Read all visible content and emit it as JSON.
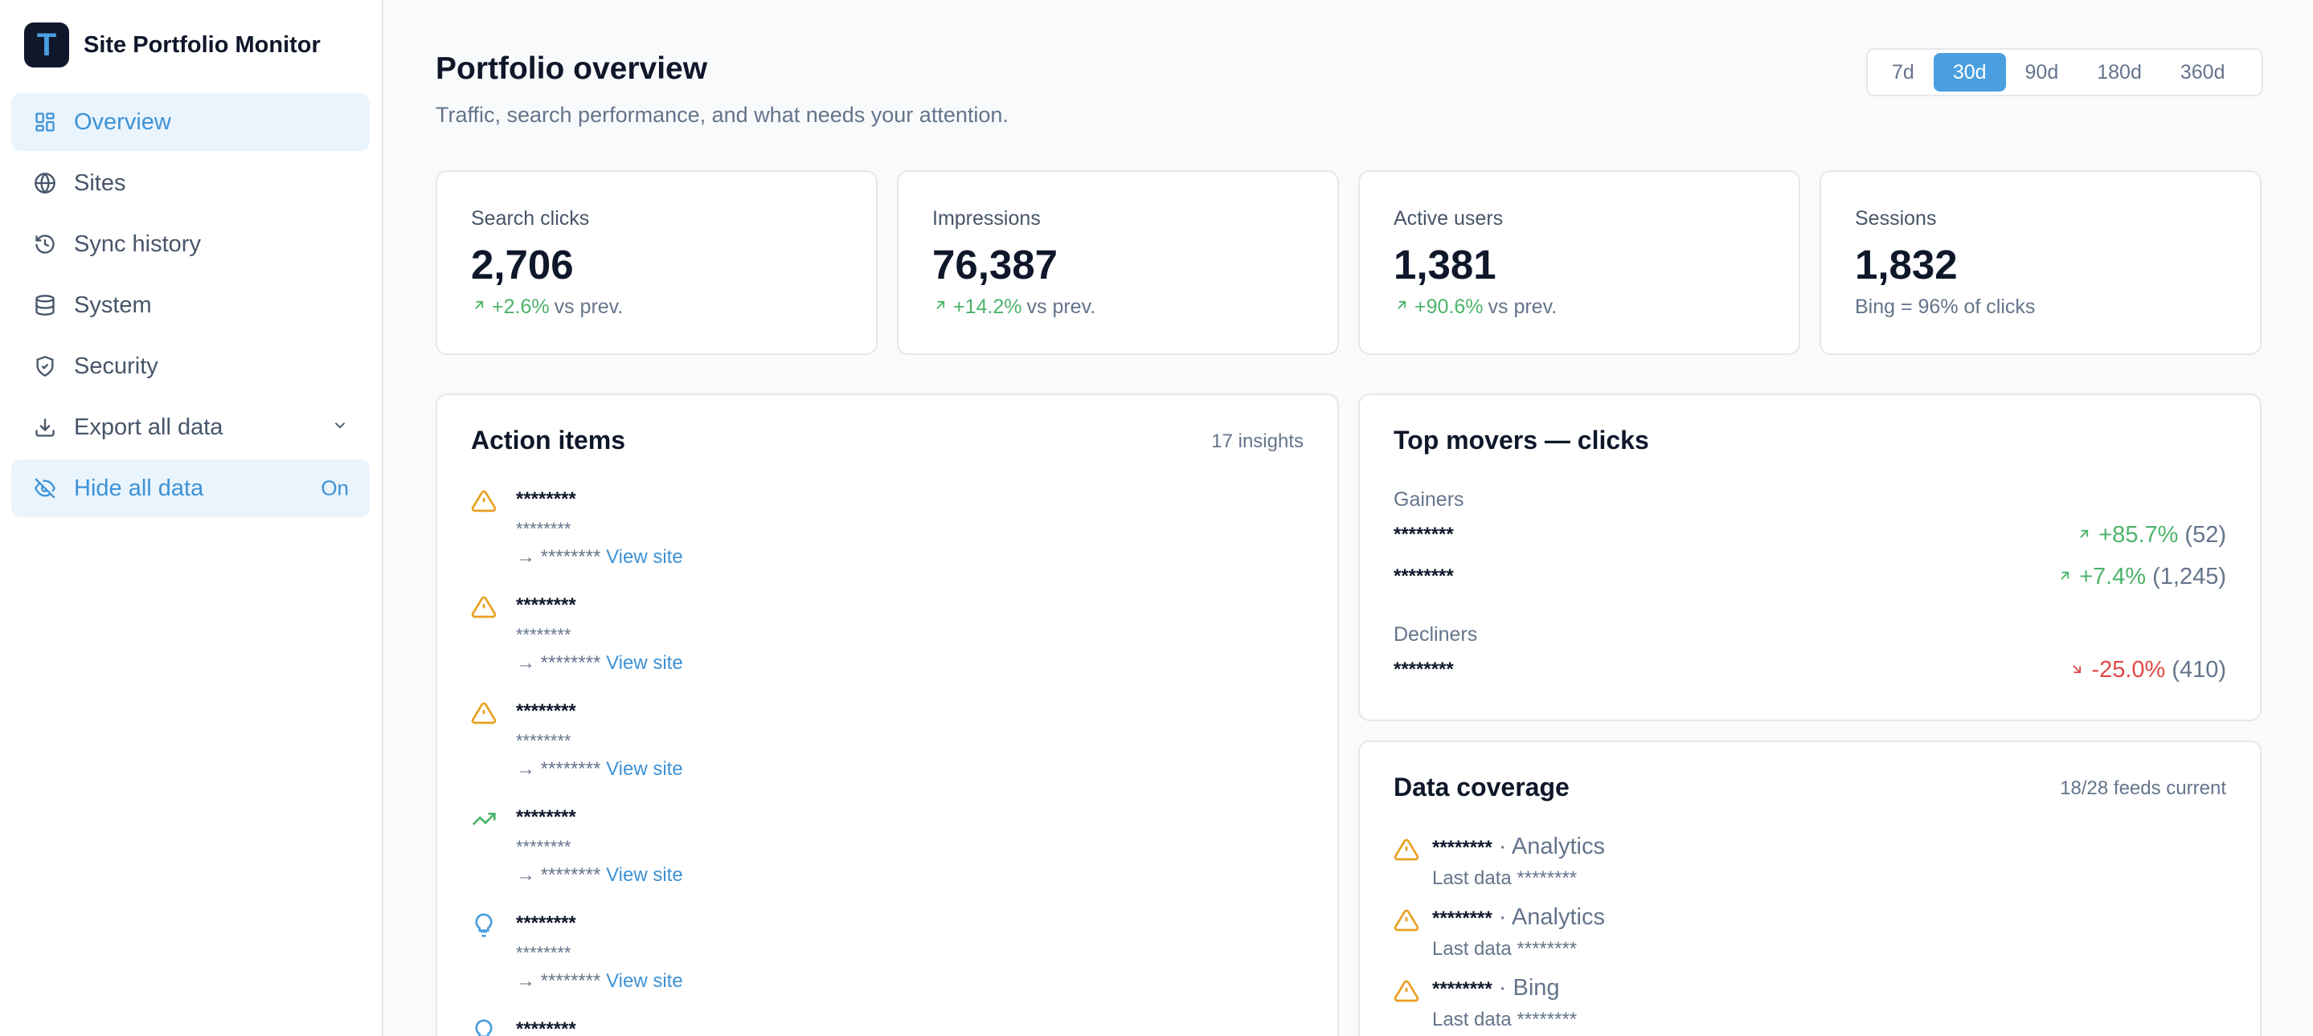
{
  "app": {
    "logo_letter": "T",
    "name": "Site Portfolio Monitor"
  },
  "colors": {
    "accent": "#4a9fe0",
    "positive": "#4cb36a",
    "negative": "#e04848",
    "warning": "#e8a020"
  },
  "sidebar": {
    "items": [
      {
        "label": "Overview",
        "icon": "dashboard-icon",
        "active": true
      },
      {
        "label": "Sites",
        "icon": "globe-icon"
      },
      {
        "label": "Sync history",
        "icon": "history-icon"
      },
      {
        "label": "System",
        "icon": "database-icon"
      },
      {
        "label": "Security",
        "icon": "shield-icon"
      },
      {
        "label": "Export all data",
        "icon": "download-icon",
        "trailing_icon": "chevron-down-icon"
      },
      {
        "label": "Hide all data",
        "icon": "eye-off-icon",
        "trailing": "On"
      }
    ]
  },
  "header": {
    "title": "Portfolio overview",
    "subtitle": "Traffic, search performance, and what needs your attention.",
    "ranges": [
      "7d",
      "30d",
      "90d",
      "180d",
      "360d"
    ],
    "selected_range": "30d"
  },
  "stats": [
    {
      "label": "Search clicks",
      "value": "2,706",
      "change": "+2.6%",
      "suffix": "vs prev."
    },
    {
      "label": "Impressions",
      "value": "76,387",
      "change": "+14.2%",
      "suffix": "vs prev."
    },
    {
      "label": "Active users",
      "value": "1,381",
      "change": "+90.6%",
      "suffix": "vs prev."
    },
    {
      "label": "Sessions",
      "value": "1,832",
      "note": "Bing = 96% of clicks"
    }
  ],
  "action_items": {
    "title": "Action items",
    "count": "17 insights",
    "items": [
      {
        "icon": "warning-icon",
        "title": "********",
        "desc": "********",
        "target": "→ ********",
        "link": "View site"
      },
      {
        "icon": "warning-icon",
        "title": "********",
        "desc": "********",
        "target": "→ ********",
        "link": "View site"
      },
      {
        "icon": "warning-icon",
        "title": "********",
        "desc": "********",
        "target": "→ ********",
        "link": "View site"
      },
      {
        "icon": "trending-up-icon",
        "title": "********",
        "desc": "********",
        "target": "→ ********",
        "link": "View site"
      },
      {
        "icon": "lightbulb-icon",
        "title": "********",
        "desc": "********",
        "target": "→ ********",
        "link": "View site"
      },
      {
        "icon": "lightbulb-icon",
        "title": "********",
        "desc": "",
        "target": "",
        "link": ""
      }
    ]
  },
  "top_movers": {
    "title": "Top movers — clicks",
    "gainers_label": "Gainers",
    "gainers": [
      {
        "name": "********",
        "change": "+85.7%",
        "count": "(52)"
      },
      {
        "name": "********",
        "change": "+7.4%",
        "count": "(1,245)"
      }
    ],
    "decliners_label": "Decliners",
    "decliners": [
      {
        "name": "********",
        "change": "-25.0%",
        "count": "(410)"
      }
    ]
  },
  "data_coverage": {
    "title": "Data coverage",
    "meta": "18/28 feeds current",
    "items": [
      {
        "site": "********",
        "source": "· Analytics",
        "last": "Last data ********"
      },
      {
        "site": "********",
        "source": "· Analytics",
        "last": "Last data ********"
      },
      {
        "site": "********",
        "source": "· Bing",
        "last": "Last data ********"
      }
    ]
  }
}
